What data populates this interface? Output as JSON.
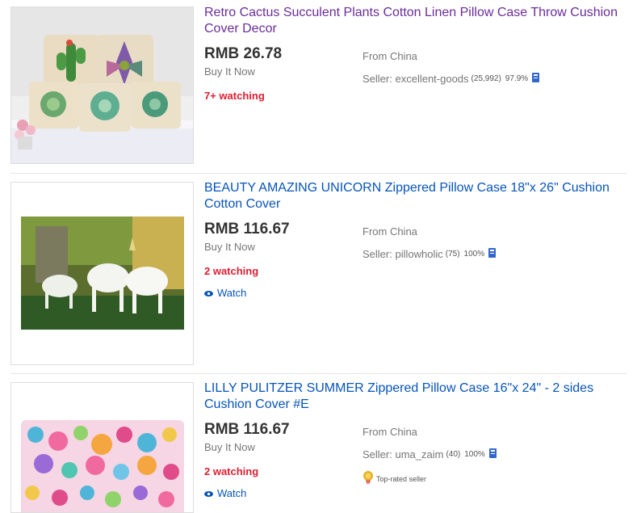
{
  "listings": [
    {
      "title": "Retro Cactus Succulent Plants Cotton Linen Pillow Case Throw Cushion Cover Decor",
      "price": "RMB 26.78",
      "format": "Buy It Now",
      "watching": "7+ watching",
      "location": "From China",
      "seller_prefix": "Seller:",
      "seller_name": "excellent-goods",
      "seller_count": "(25,992)",
      "seller_pct": "97.9%",
      "image_icon": "cactus-pillows-photo"
    },
    {
      "title": "BEAUTY AMAZING UNICORN Zippered Pillow Case 18\"x 26\" Cushion Cotton Cover",
      "price": "RMB 116.67",
      "format": "Buy It Now",
      "watching": "2 watching",
      "watch_label": "Watch",
      "location": "From China",
      "seller_prefix": "Seller:",
      "seller_name": "pillowholic",
      "seller_count": "(75)",
      "seller_pct": "100%",
      "image_icon": "unicorn-pillow-photo"
    },
    {
      "title": "LILLY PULITZER SUMMER Zippered Pillow Case 16\"x 24\" - 2 sides Cushion Cover #E",
      "price": "RMB 116.67",
      "format": "Buy It Now",
      "watching": "2 watching",
      "watch_label": "Watch",
      "location": "From China",
      "seller_prefix": "Seller:",
      "seller_name": "uma_zaim",
      "seller_count": "(40)",
      "seller_pct": "100%",
      "badge": "Top-rated seller",
      "image_icon": "coral-pattern-pillow-photo"
    }
  ],
  "colors": {
    "link": "#0654ba",
    "visited_link": "#6b2c9a",
    "watching_red": "#dd1e31",
    "price": "#333333",
    "muted": "#767676"
  },
  "icons": {
    "watch": "eye-icon",
    "seller_feedback": "feedback-book-icon",
    "top_rated": "top-rated-medal-icon"
  }
}
